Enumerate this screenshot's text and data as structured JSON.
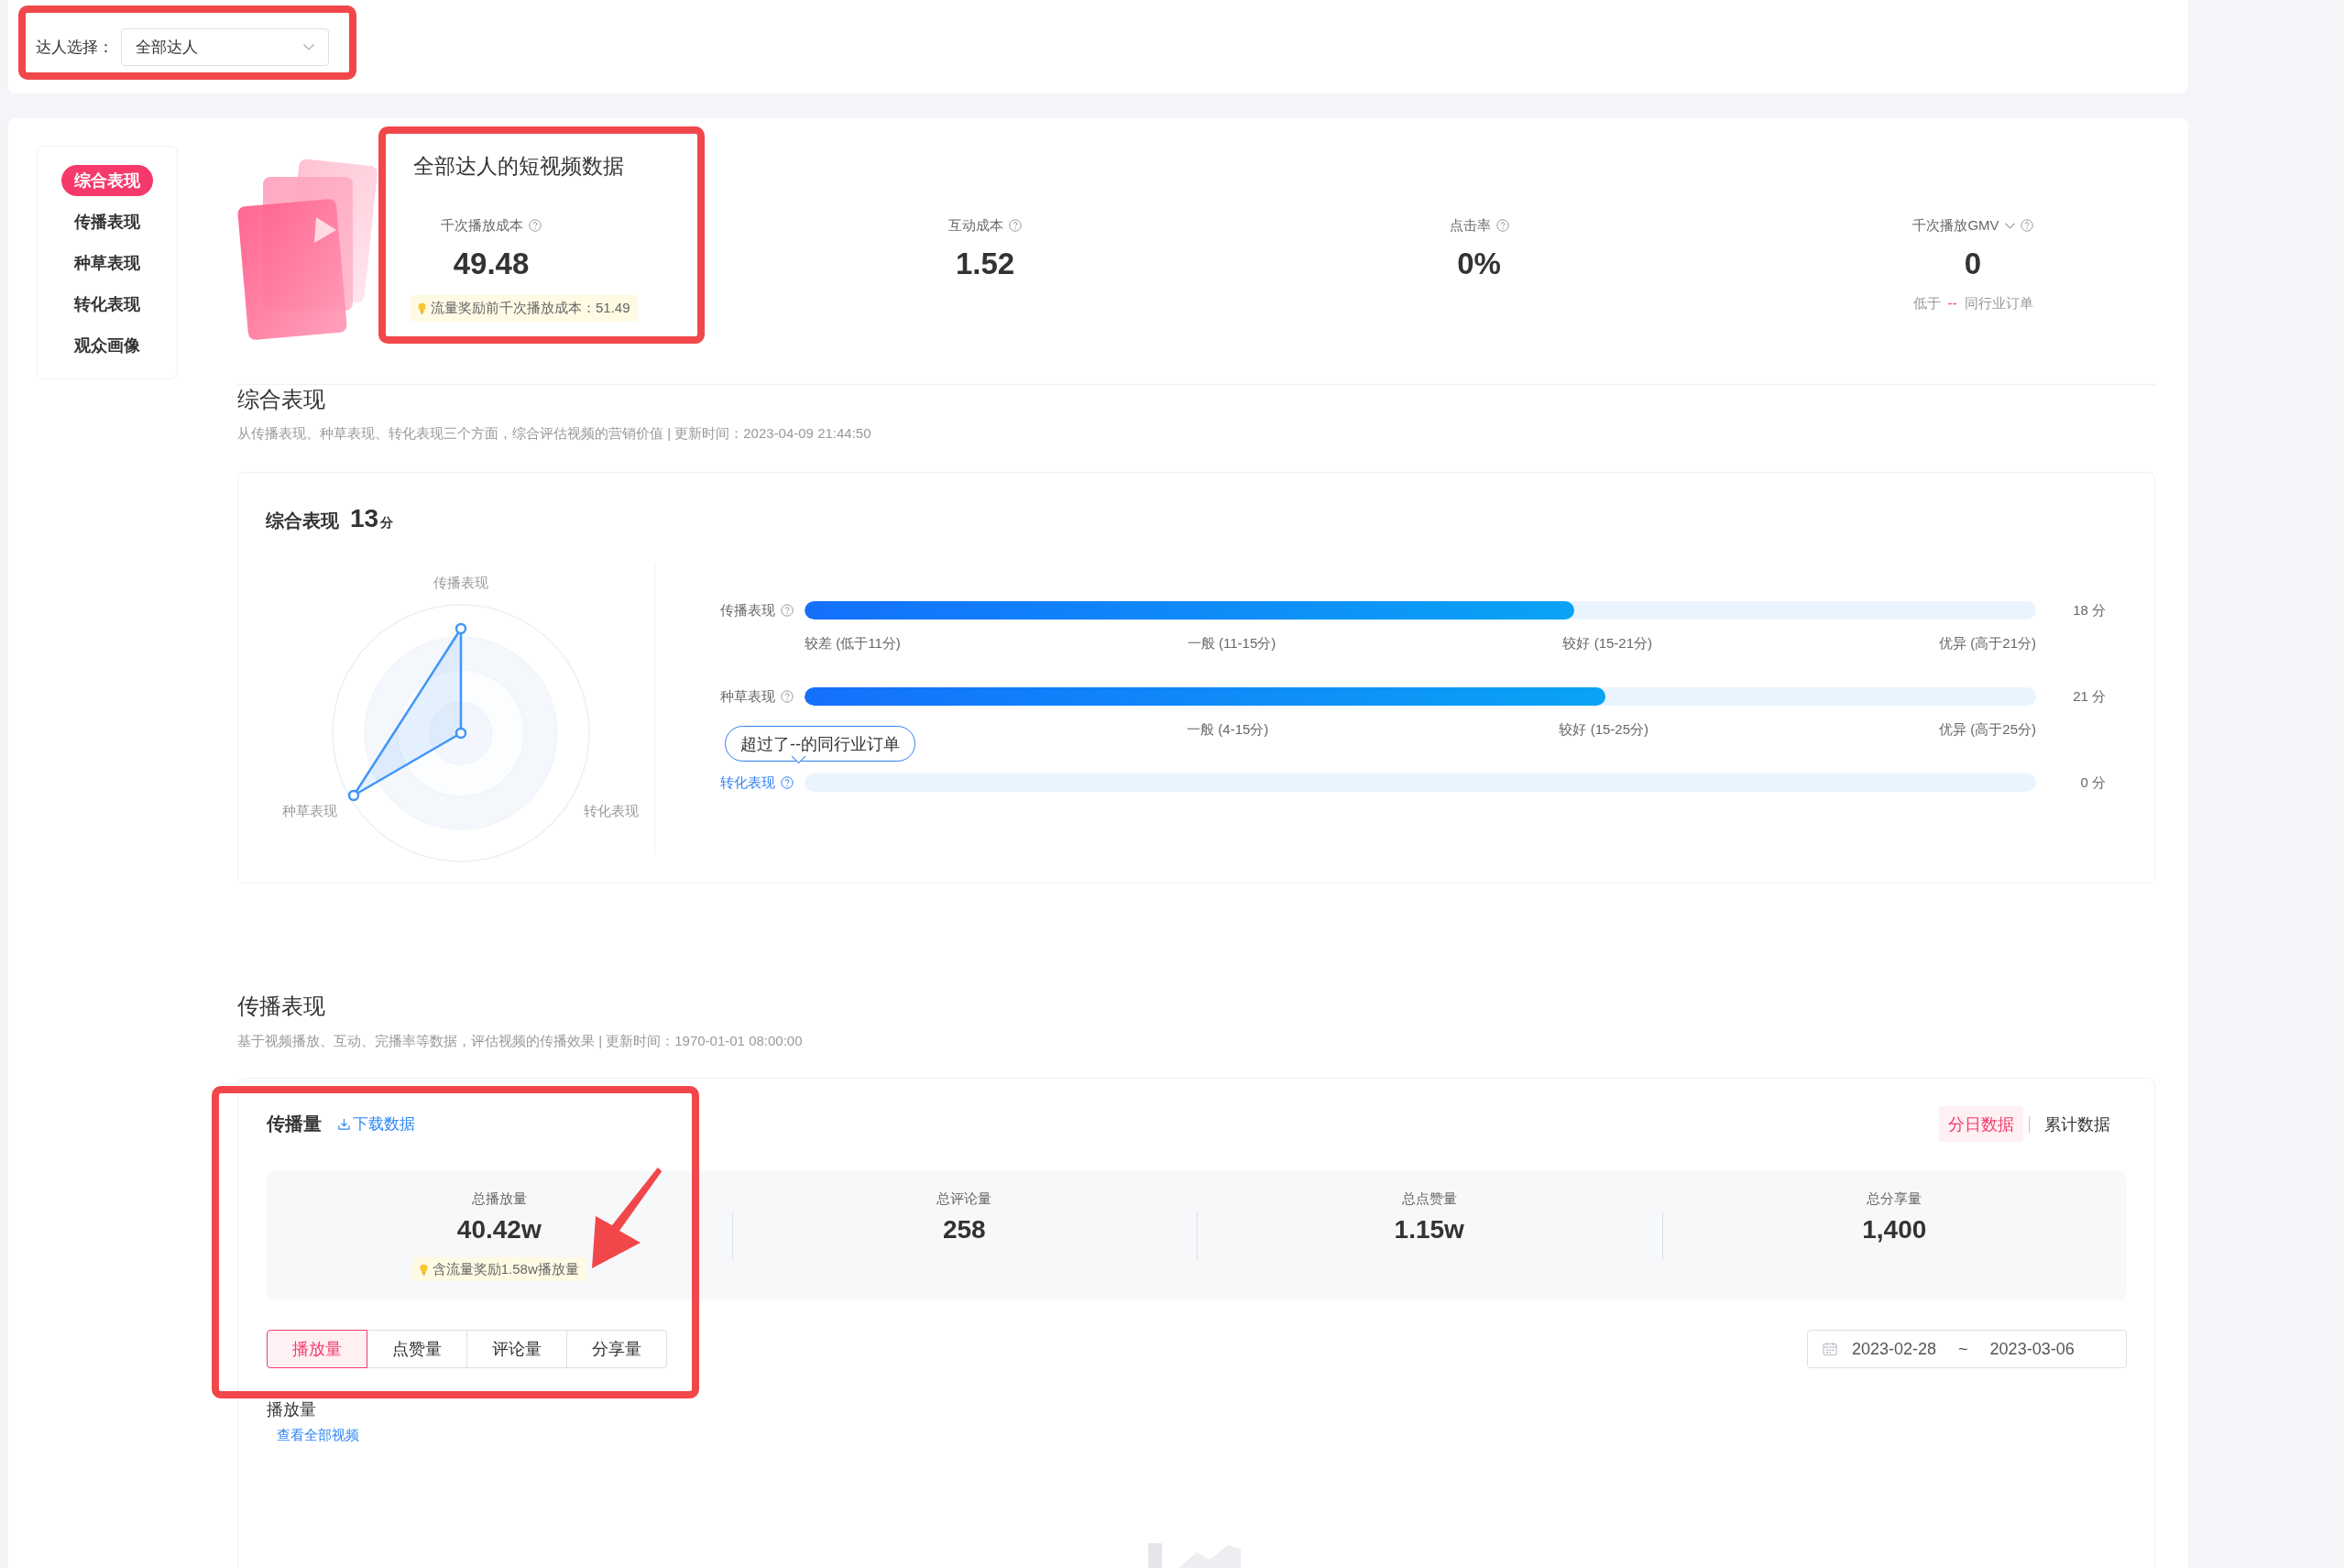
{
  "filter": {
    "label": "达人选择：",
    "value": "全部达人"
  },
  "sidebar": {
    "items": [
      {
        "label": "综合表现",
        "selected": true
      },
      {
        "label": "传播表现",
        "selected": false
      },
      {
        "label": "种草表现",
        "selected": false
      },
      {
        "label": "转化表现",
        "selected": false
      },
      {
        "label": "观众画像",
        "selected": false
      }
    ]
  },
  "overview": {
    "title": "全部达人的短视频数据",
    "metrics": [
      {
        "kind": "plain",
        "label": "千次播放成本",
        "value": "49.48",
        "tip": "流量奖励前千次播放成本：51.49"
      },
      {
        "kind": "plain",
        "label": "互动成本",
        "value": "1.52"
      },
      {
        "kind": "plain",
        "label": "点击率",
        "value": "0%"
      },
      {
        "kind": "dropdown",
        "label": "千次播放GMV",
        "value": "0",
        "comparison": {
          "prefix": "低于",
          "value": "--",
          "suffix": "同行业订单"
        }
      }
    ]
  },
  "composite": {
    "title": "综合表现",
    "description": "从传播表现、种草表现、转化表现三个方面，综合评估视频的营销价值 | 更新时间：2023-04-09 21:44:50",
    "card_title": "综合表现",
    "score": "13",
    "score_unit": "分",
    "radar_labels": [
      "传播表现",
      "种草表现",
      "转化表现"
    ],
    "rows": [
      {
        "label": "传播表现",
        "active": false,
        "level": 0.625,
        "score": "18 分",
        "ticks": [
          "较差 (低于11分)",
          "一般 (11-15分)",
          "较好 (15-21分)",
          "优异 (高于21分)"
        ]
      },
      {
        "label": "种草表现",
        "active": false,
        "level": 0.65,
        "score": "21 分",
        "ticks": [
          "一般 (4-15分)",
          "较好 (15-25分)",
          "优异 (高于25分)"
        ]
      },
      {
        "label": "转化表现",
        "active": true,
        "level": 0,
        "score": "0 分",
        "tooltip": "超过了--的同行业订单"
      }
    ]
  },
  "spread": {
    "title": "传播表现",
    "description": "基于视频播放、互动、完播率等数据，评估视频的传播效果 | 更新时间：1970-01-01 08:00:00",
    "card_title": "传播量",
    "download": "下载数据",
    "modes": [
      {
        "label": "分日数据",
        "selected": true
      },
      {
        "label": "累计数据",
        "selected": false
      }
    ],
    "stats": [
      {
        "label": "总播放量",
        "value": "40.42w",
        "tip": "含流量奖励1.58w播放量"
      },
      {
        "label": "总评论量",
        "value": "258"
      },
      {
        "label": "总点赞量",
        "value": "1.15w"
      },
      {
        "label": "总分享量",
        "value": "1,400"
      }
    ],
    "tabs": [
      {
        "label": "播放量",
        "selected": true
      },
      {
        "label": "点赞量",
        "selected": false
      },
      {
        "label": "评论量",
        "selected": false
      },
      {
        "label": "分享量",
        "selected": false
      }
    ],
    "date_range": {
      "start": "2023-02-28",
      "separator": "~",
      "end": "2023-03-06"
    },
    "chart_title": "播放量",
    "view_all": "查看全部视频"
  }
}
